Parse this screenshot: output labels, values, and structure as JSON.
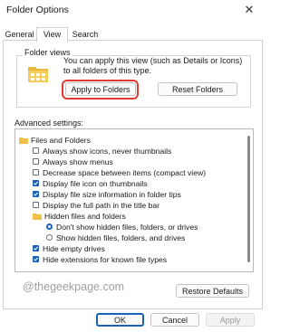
{
  "window": {
    "title": "Folder Options",
    "close_icon": "close-icon"
  },
  "tabs": [
    {
      "label": "General",
      "active": false
    },
    {
      "label": "View",
      "active": true
    },
    {
      "label": "Search",
      "active": false
    }
  ],
  "folder_views": {
    "heading": "Folder views",
    "description": "You can apply this view (such as Details or Icons) to all folders of this type.",
    "apply_label": "Apply to Folders",
    "reset_label": "Reset Folders"
  },
  "advanced": {
    "label": "Advanced settings:",
    "items": [
      {
        "label": "Files and Folders",
        "kind": "folder",
        "checked": false
      },
      {
        "label": "Always show icons, never thumbnails",
        "kind": "checkbox",
        "checked": false
      },
      {
        "label": "Always show menus",
        "kind": "checkbox",
        "checked": false
      },
      {
        "label": "Decrease space between items (compact view)",
        "kind": "checkbox",
        "checked": false
      },
      {
        "label": "Display file icon on thumbnails",
        "kind": "checkbox",
        "checked": true
      },
      {
        "label": "Display file size information in folder tips",
        "kind": "checkbox",
        "checked": true
      },
      {
        "label": "Display the full path in the title bar",
        "kind": "checkbox",
        "checked": false
      },
      {
        "label": "Hidden files and folders",
        "kind": "folder",
        "checked": false
      },
      {
        "label": "Don't show hidden files, folders, or drives",
        "kind": "radio",
        "checked": true
      },
      {
        "label": "Show hidden files, folders, and drives",
        "kind": "radio",
        "checked": false
      },
      {
        "label": "Hide empty drives",
        "kind": "checkbox",
        "checked": true
      },
      {
        "label": "Hide extensions for known file types",
        "kind": "checkbox",
        "checked": true
      }
    ]
  },
  "restore_label": "Restore Defaults",
  "watermark": "@thegeekpage.com",
  "footer": {
    "ok": "OK",
    "cancel": "Cancel",
    "apply": "Apply"
  }
}
